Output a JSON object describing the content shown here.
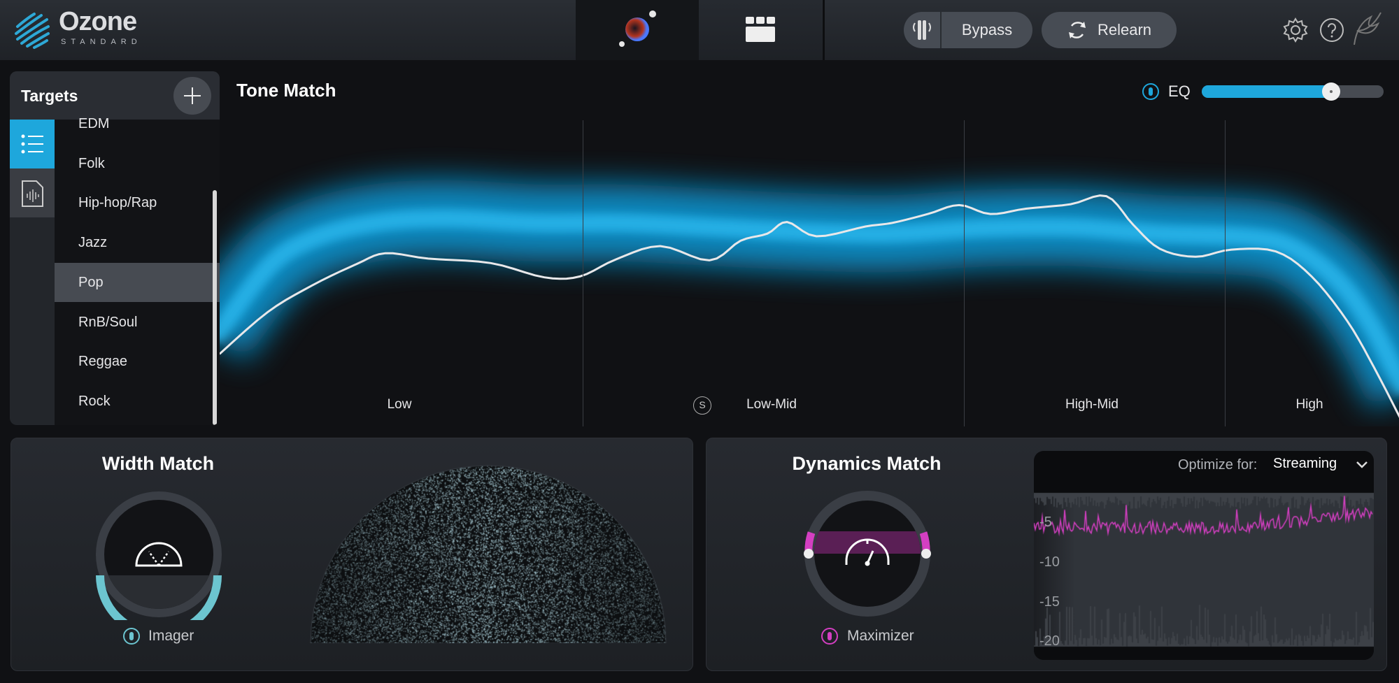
{
  "app": {
    "name": "Ozone",
    "edition": "STANDARD"
  },
  "header": {
    "bypass_label": "Bypass",
    "relearn_label": "Relearn"
  },
  "targets": {
    "title": "Targets",
    "items": [
      "EDM",
      "Folk",
      "Hip-hop/Rap",
      "Jazz",
      "Pop",
      "RnB/Soul",
      "Reggae",
      "Rock"
    ],
    "selected": "Pop"
  },
  "tone_match": {
    "title": "Tone Match",
    "eq_label": "EQ",
    "eq_amount_percent": 71,
    "bands": [
      "Low",
      "Low-Mid",
      "High-Mid",
      "High"
    ],
    "solo_label": "S"
  },
  "width_match": {
    "title": "Width Match",
    "module_label": "Imager"
  },
  "dynamics_match": {
    "title": "Dynamics Match",
    "module_label": "Maximizer",
    "optimize_label": "Optimize for:",
    "optimize_value": "Streaming",
    "scale_ticks": [
      "-5",
      "-10",
      "-15",
      "-20"
    ]
  },
  "colors": {
    "accent_blue": "#1ea7dc",
    "imager_cyan": "#6cc5d0",
    "maximizer_magenta": "#d43fc2",
    "panel": "#23262b"
  }
}
